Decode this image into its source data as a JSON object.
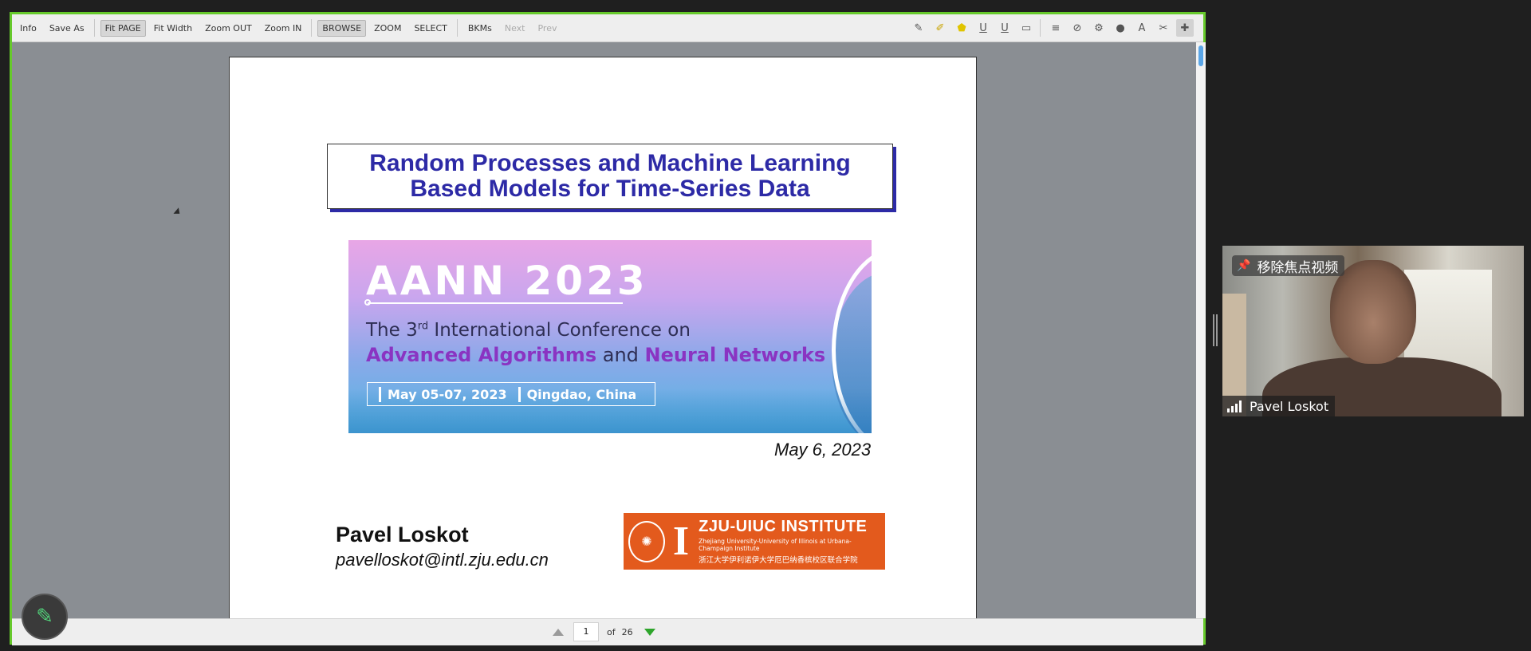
{
  "toolbar": {
    "info": "Info",
    "save_as": "Save As",
    "fit_page": "Fit PAGE",
    "fit_width": "Fit Width",
    "zoom_out": "Zoom OUT",
    "zoom_in": "Zoom IN",
    "browse": "BROWSE",
    "zoom": "ZOOM",
    "select": "SELECT",
    "bkms": "BKMs",
    "next": "Next",
    "prev": "Prev"
  },
  "slide": {
    "title_line1": "Random Processes and Machine Learning",
    "title_line2": "Based Models for Time-Series Data",
    "banner": {
      "title": "AANN 2023",
      "sub_prefix": "The 3",
      "sub_sup": "rd",
      "sub_rest": " International Conference on",
      "sub2_a": "Advanced Algorithms",
      "sub2_and": " and ",
      "sub2_b": "Neural Networks",
      "date": "May 05-07, 2023",
      "place": "Qingdao, China"
    },
    "date": "May 6, 2023",
    "author_name": "Pavel Loskot",
    "author_email": "pavelloskot@intl.zju.edu.cn",
    "institute": {
      "name": "ZJU-UIUC INSTITUTE",
      "subtitle": "Zhejiang University-University of Illinois at Urbana-Champaign Institute",
      "chinese": "浙江大学伊利诺伊大学厄巴纳香槟校区联合学院"
    }
  },
  "statusbar": {
    "page": "1",
    "of_label": "of",
    "total": "26"
  },
  "video": {
    "pin_label": "移除焦点视频",
    "participant": "Pavel Loskot"
  },
  "colors": {
    "frame_border": "#66c92b",
    "title_blue": "#2d2aa6",
    "institute_orange": "#e35a1d",
    "pen_green": "#52d37a"
  }
}
